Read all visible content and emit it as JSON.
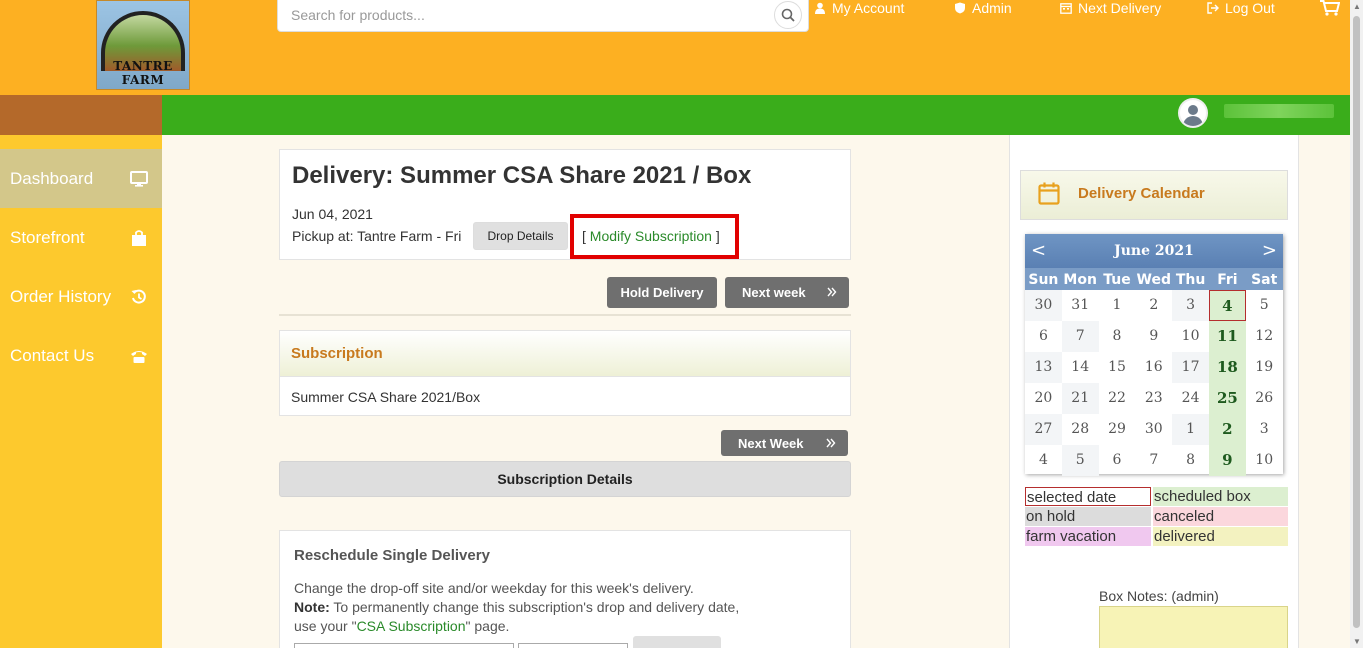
{
  "header": {
    "logo_text": "TANTRE FARM",
    "search_placeholder": "Search for products...",
    "nav": {
      "my_account": "My Account",
      "admin": "Admin",
      "next_delivery": "Next Delivery",
      "log_out": "Log Out"
    }
  },
  "sidebar": {
    "items": [
      {
        "label": "Dashboard",
        "icon": "monitor-icon",
        "active": true
      },
      {
        "label": "Storefront",
        "icon": "shopping-bag-icon"
      },
      {
        "label": "Order History",
        "icon": "history-icon"
      },
      {
        "label": "Contact Us",
        "icon": "phone-icon"
      }
    ]
  },
  "delivery": {
    "title": "Delivery: Summer CSA Share 2021 / Box",
    "date": "Jun 04, 2021",
    "pickup": "Pickup at: Tantre Farm - Fri",
    "drop_details_label": "Drop Details",
    "modify_open": "[",
    "modify_label": "Modify Subscription",
    "modify_close": "]",
    "hold_label": "Hold Delivery",
    "next_week_label": "Next week"
  },
  "subscription": {
    "header": "Subscription",
    "name": "Summer CSA Share 2021/Box",
    "next_week_label": "Next Week",
    "details_label": "Subscription Details"
  },
  "reschedule": {
    "title": "Reschedule Single Delivery",
    "line1": "Change the drop-off site and/or weekday for this week's delivery.",
    "note_label": "Note:",
    "note_text": " To permanently change this subscription's drop and delivery date,",
    "line3_prefix": "use your \"",
    "line3_link": "CSA Subscription",
    "line3_suffix": "\" page."
  },
  "calendar": {
    "header": "Delivery Calendar",
    "month": "June 2021",
    "prev": "<",
    "next": ">",
    "days_of_week": [
      "Sun",
      "Mon",
      "Tue",
      "Wed",
      "Thu",
      "Fri",
      "Sat"
    ],
    "weeks": [
      [
        "30",
        "31",
        "1",
        "2",
        "3",
        "4",
        "5"
      ],
      [
        "6",
        "7",
        "8",
        "9",
        "10",
        "11",
        "12"
      ],
      [
        "13",
        "14",
        "15",
        "16",
        "17",
        "18",
        "19"
      ],
      [
        "20",
        "21",
        "22",
        "23",
        "24",
        "25",
        "26"
      ],
      [
        "27",
        "28",
        "29",
        "30",
        "1",
        "2",
        "3"
      ],
      [
        "4",
        "5",
        "6",
        "7",
        "8",
        "9",
        "10"
      ]
    ],
    "selected": {
      "week": 0,
      "day": 5
    },
    "legend": [
      {
        "label": "selected date",
        "color": "#ffffff",
        "border": "#b52e2e"
      },
      {
        "label": "scheduled box",
        "color": "#dcefd0"
      },
      {
        "label": "on hold",
        "color": "#dcdcdc"
      },
      {
        "label": "canceled",
        "color": "#fbd7dd"
      },
      {
        "label": "farm vacation",
        "color": "#f0c8ef"
      },
      {
        "label": "delivered",
        "color": "#f3f2c0"
      }
    ]
  },
  "box_notes_label": "Box Notes: (admin)",
  "colors": {
    "header_orange": "#fdb022",
    "nav_green": "#3aad1b",
    "sidebar_yellow": "#fdc92d",
    "highlight_red": "#e10000"
  }
}
